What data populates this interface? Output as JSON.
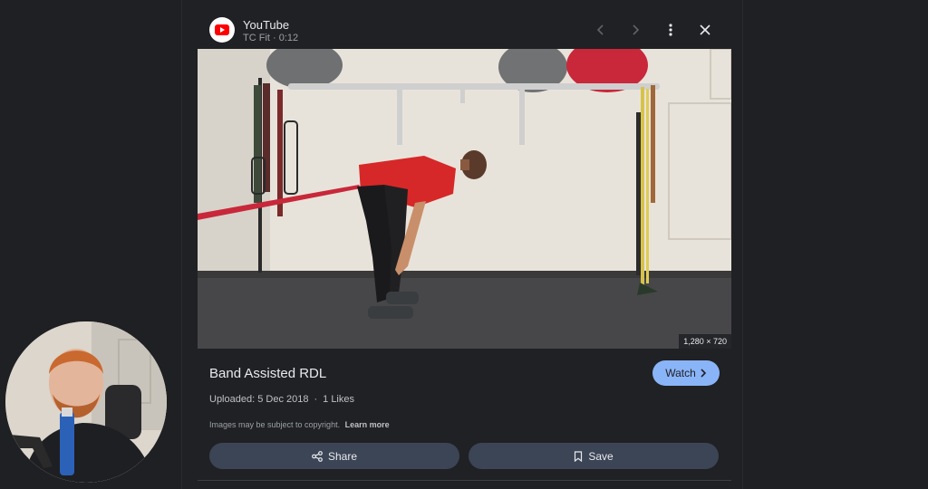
{
  "header": {
    "site_name": "YouTube",
    "channel_time": "TC Fit · 0:12"
  },
  "image": {
    "dimensions": "1,280 × 720",
    "subject": "man in red shirt performing band assisted romanian deadlift in a gym"
  },
  "result": {
    "title": "Band Assisted RDL",
    "watch_label": "Watch",
    "uploaded": "Uploaded: 5 Dec 2018",
    "separator": "·",
    "likes": "1 Likes"
  },
  "copyright": {
    "notice": "Images may be subject to copyright.",
    "learn_more": "Learn more"
  },
  "actions": {
    "share_label": "Share",
    "save_label": "Save"
  },
  "icons": {
    "logo": "youtube-logo-icon",
    "prev": "chevron-left-icon",
    "next": "chevron-right-icon",
    "more": "more-vert-icon",
    "close": "close-icon",
    "watch": "chevron-right-icon",
    "share": "share-icon",
    "save": "bookmark-icon"
  },
  "colors": {
    "background": "#202124",
    "accent": "#8ab4f8",
    "action_button": "#3c4556",
    "youtube_red": "#ff0000"
  }
}
